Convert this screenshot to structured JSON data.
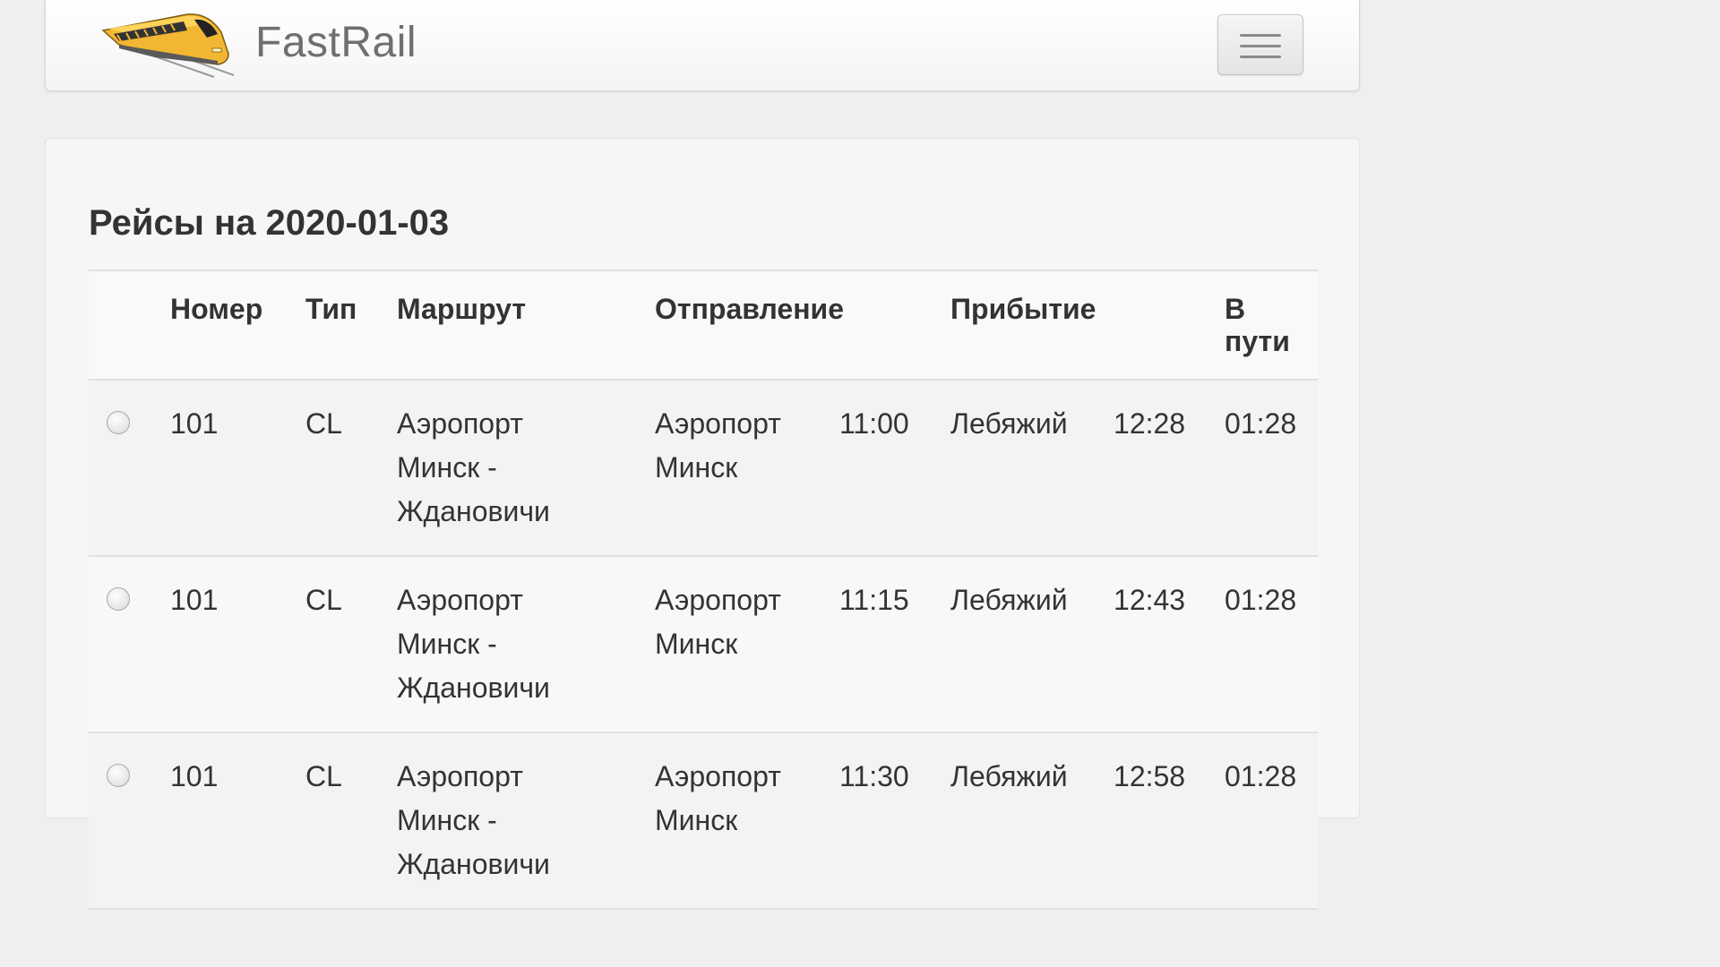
{
  "navbar": {
    "brand": "FastRail",
    "logo_icon": "train-logo-icon",
    "menu_icon": "hamburger-menu-icon"
  },
  "page": {
    "title": "Рейсы на 2020-01-03"
  },
  "table": {
    "headers": {
      "number": "Номер",
      "type": "Тип",
      "route": "Маршрут",
      "departure": "Отправление",
      "arrival": "Прибытие",
      "duration": "В пути"
    },
    "rows": [
      {
        "number": "101",
        "type": "CL",
        "route": "Аэропорт Минск - Ждановичи",
        "dep_station": "Аэропорт Минск",
        "dep_time": "11:00",
        "arr_station": "Лебяжий",
        "arr_time": "12:28",
        "duration": "01:28"
      },
      {
        "number": "101",
        "type": "CL",
        "route": "Аэропорт Минск - Ждановичи",
        "dep_station": "Аэропорт Минск",
        "dep_time": "11:15",
        "arr_station": "Лебяжий",
        "arr_time": "12:43",
        "duration": "01:28"
      },
      {
        "number": "101",
        "type": "CL",
        "route": "Аэропорт Минск - Ждановичи",
        "dep_station": "Аэропорт Минск",
        "dep_time": "11:30",
        "arr_station": "Лебяжий",
        "arr_time": "12:58",
        "duration": "01:28"
      }
    ]
  },
  "colors": {
    "logo_yellow": "#f2b632",
    "background": "#efefef"
  }
}
